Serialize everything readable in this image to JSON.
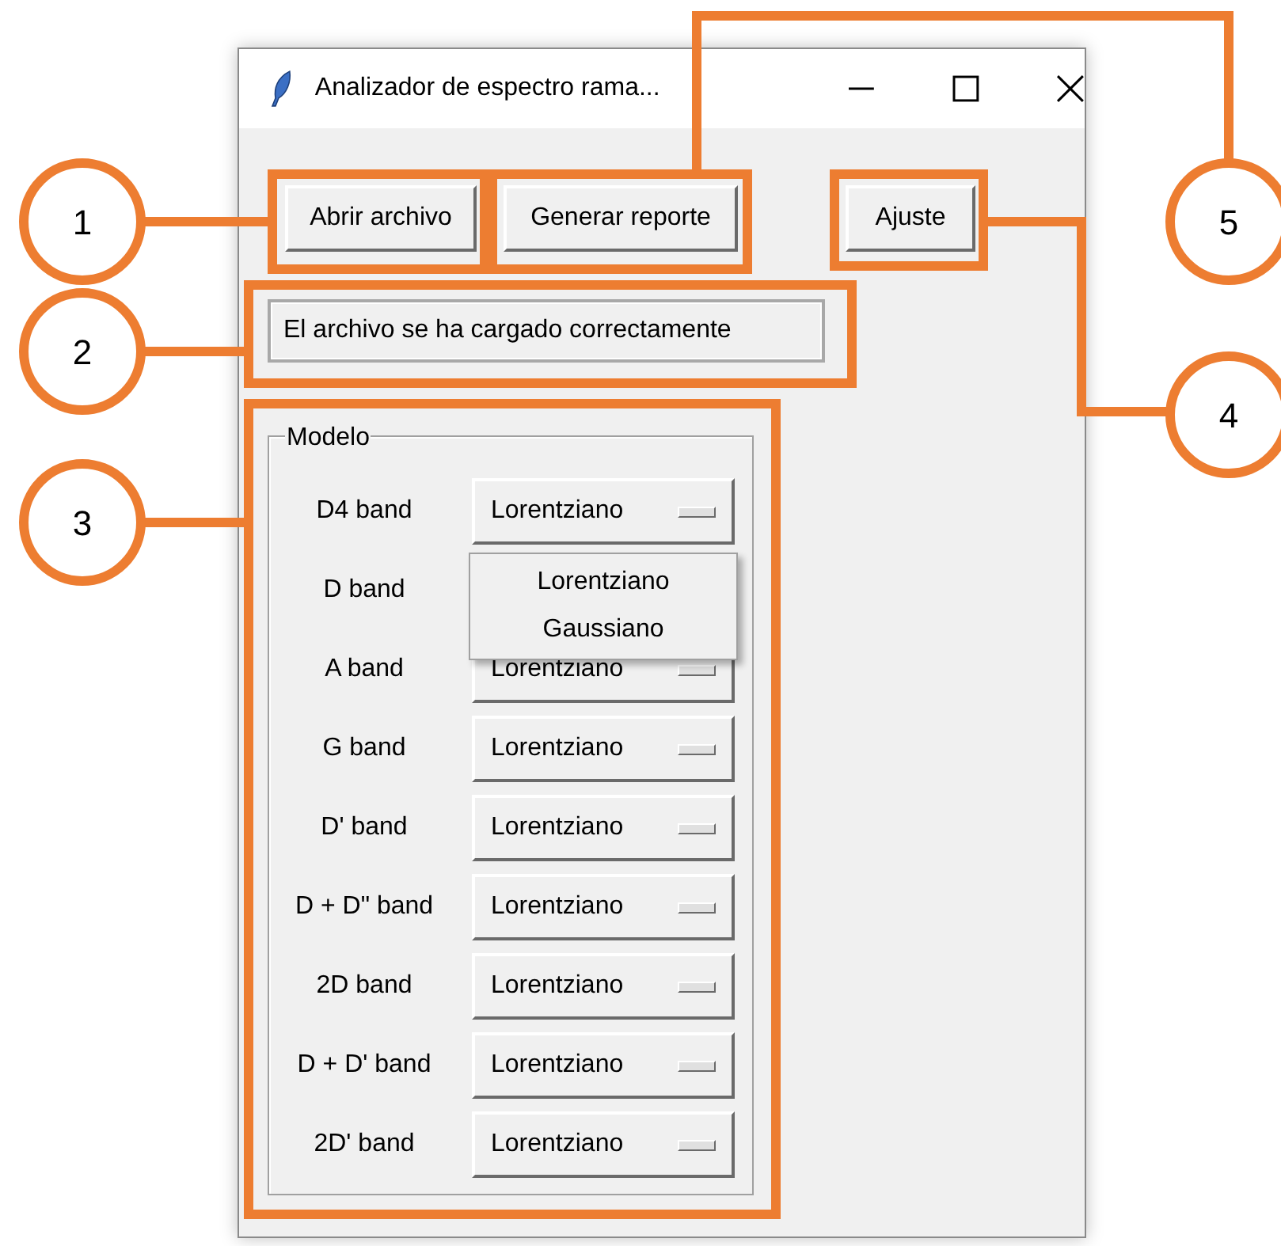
{
  "window": {
    "title": "Analizador de espectro rama..."
  },
  "buttons": [
    {
      "label": "Abrir archivo"
    },
    {
      "label": "Generar reporte"
    },
    {
      "label": "Ajuste"
    }
  ],
  "status": "El archivo se ha cargado correctamente",
  "model_frame": {
    "title": "Modelo",
    "rows": [
      {
        "label": "D4 band",
        "value": "Lorentziano"
      },
      {
        "label": "D band"
      },
      {
        "label": "A band",
        "value": "Lorentziano"
      },
      {
        "label": "G band",
        "value": "Lorentziano"
      },
      {
        "label": "D' band",
        "value": "Lorentziano"
      },
      {
        "label": "D + D\" band",
        "value": "Lorentziano"
      },
      {
        "label": "2D band",
        "value": "Lorentziano"
      },
      {
        "label": "D + D' band",
        "value": "Lorentziano"
      },
      {
        "label": "2D' band",
        "value": "Lorentziano"
      }
    ],
    "dropdown": {
      "items": [
        "Lorentziano",
        "Gaussiano"
      ]
    }
  },
  "annotations": [
    {
      "number": "1"
    },
    {
      "number": "5"
    },
    {
      "number": "2"
    },
    {
      "number": "4"
    },
    {
      "number": "3"
    }
  ]
}
